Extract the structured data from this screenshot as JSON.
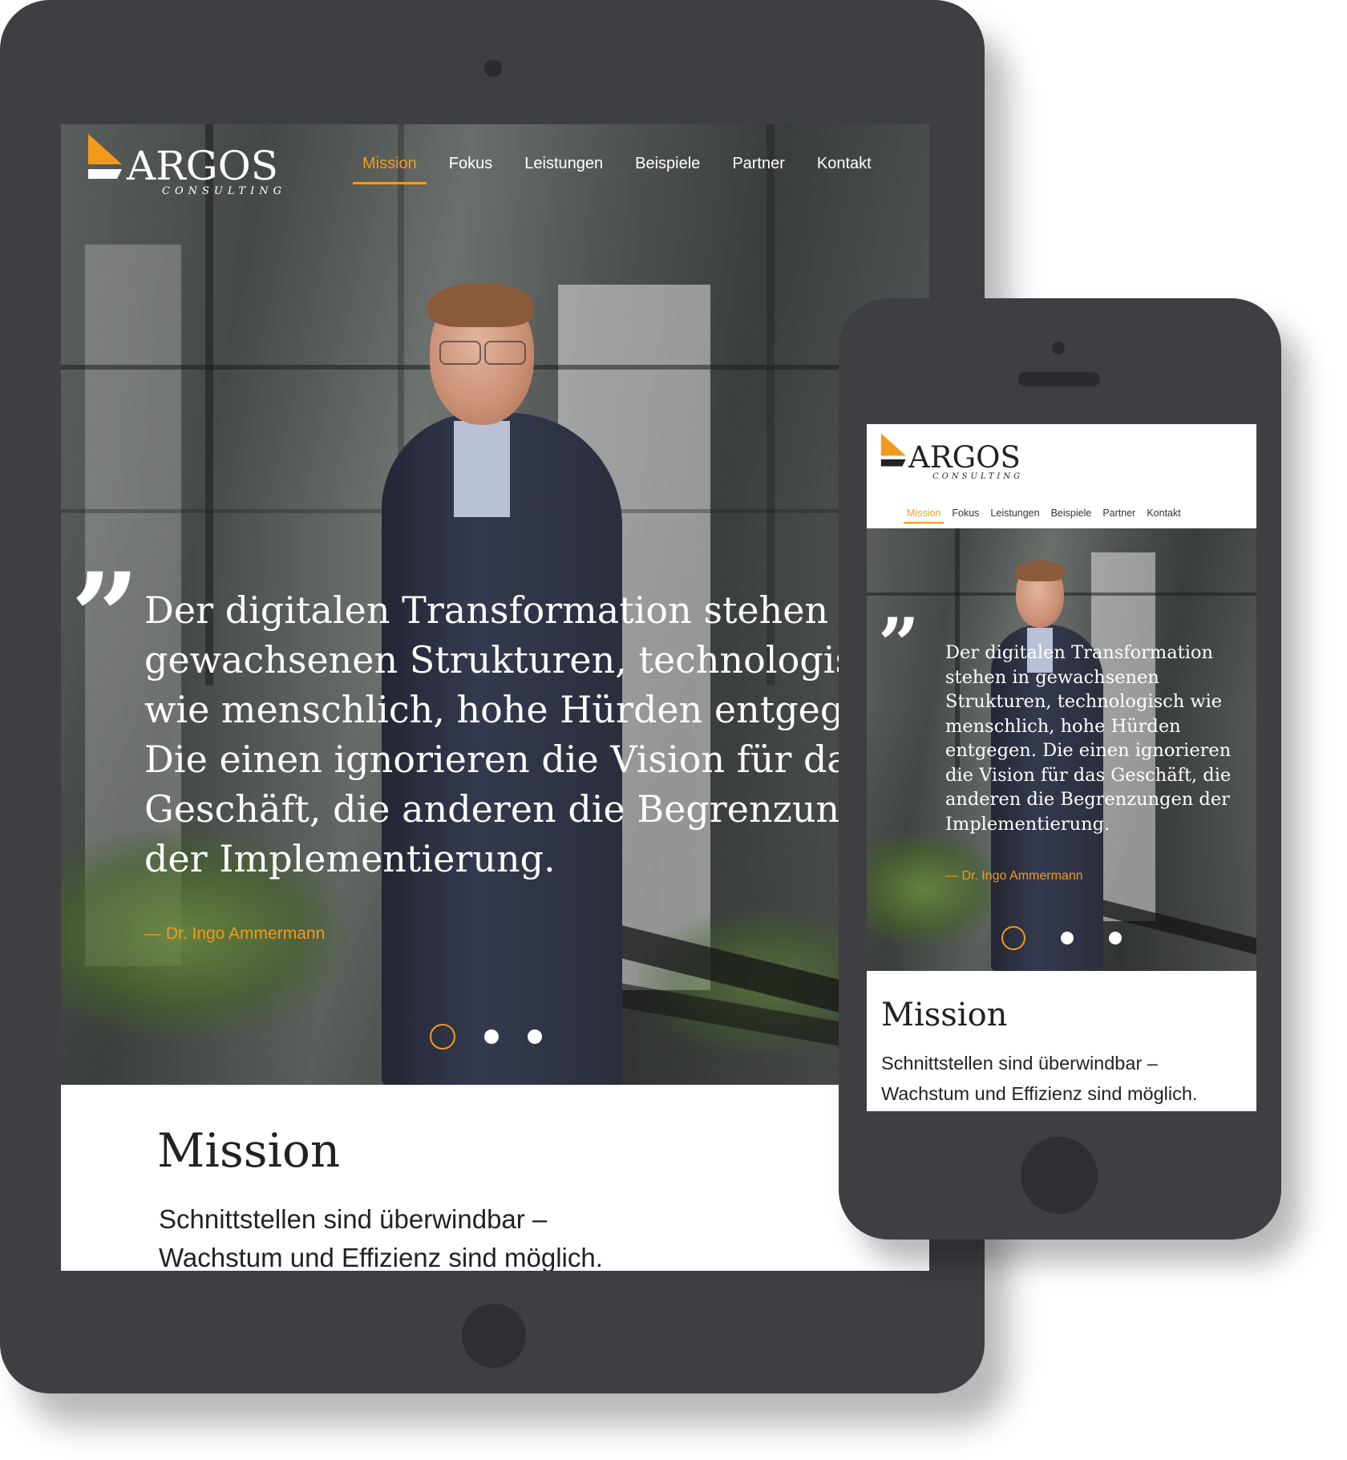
{
  "brand": {
    "name": "ARGOS",
    "sub": "CONSULTING",
    "accent": "#f39a1c",
    "device_color": "#3f3e43"
  },
  "nav": {
    "items": [
      {
        "label": "Mission",
        "active": true
      },
      {
        "label": "Fokus",
        "active": false
      },
      {
        "label": "Leistungen",
        "active": false
      },
      {
        "label": "Beispiele",
        "active": false
      },
      {
        "label": "Partner",
        "active": false
      },
      {
        "label": "Kontakt",
        "active": false
      }
    ]
  },
  "hero": {
    "quote_mark": "”",
    "tablet_quote_lines": [
      "Der digitalen Transformation stehen",
      "gewachsenen Strukturen, technologis",
      "wie menschlich, hohe Hürden entgeg",
      "Die einen ignorieren die Vision für da",
      "Geschäft, die anderen die Begrenzun",
      "der Implementierung."
    ],
    "phone_quote_lines": [
      "Der digitalen Transformation",
      "stehen in gewachsenen",
      "Strukturen, technologisch wie",
      "menschlich, hohe Hürden",
      "entgegen. Die einen ignorieren",
      "die Vision für das Geschäft, die",
      "anderen die Begrenzungen der",
      "Implementierung."
    ],
    "author": "— Dr. Ingo Ammermann",
    "slides": 3,
    "active_slide": 1
  },
  "mission": {
    "title": "Mission",
    "line1": "Schnittstellen sind überwindbar –",
    "line2": "Wachstum und Effizienz sind möglich."
  }
}
